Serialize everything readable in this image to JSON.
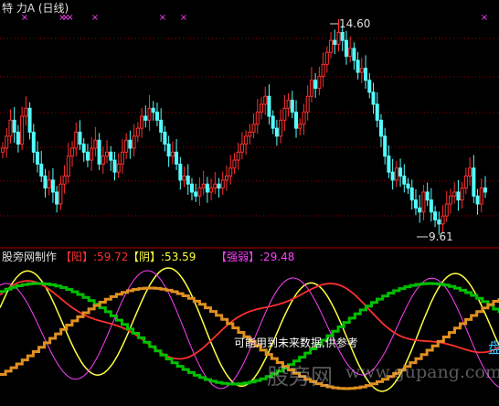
{
  "header": {
    "title": "特 力A (日线)"
  },
  "price_panel": {
    "high_label": "14.60",
    "low_label": "9.61"
  },
  "indicator_panel": {
    "label_prefix": "股旁网制作",
    "yang": {
      "name": "【阳】",
      "value": ":59.72",
      "color": "#ff3030"
    },
    "yin": {
      "name": "【阴】",
      "value": ":53.59",
      "color": "#ffff40"
    },
    "qiangruo": {
      "name": "【强弱】",
      "value": ":29.48",
      "color": "#ff40ff"
    },
    "note": "可能用到未来数据,供参考",
    "side_glyph": "盘"
  },
  "watermark": {
    "cn": "股旁网",
    "url": "www.gupang.com"
  },
  "colors": {
    "up": "#ff3030",
    "down": "#54ffff",
    "grid": "#a00000",
    "signal": "#ff40ff",
    "green_step": "#00c000",
    "orange_step": "#e09020"
  },
  "chart_data": [
    {
      "type": "candlestick",
      "title": "特 力A (日线)",
      "annotations": [
        {
          "text": "14.60",
          "kind": "high"
        },
        {
          "text": "9.61",
          "kind": "low"
        }
      ],
      "close": [
        11.6,
        11.9,
        12.3,
        12.0,
        11.7,
        12.4,
        12.6,
        12.0,
        11.5,
        11.2,
        10.9,
        10.6,
        10.8,
        10.5,
        10.2,
        10.7,
        10.9,
        11.4,
        11.6,
        12.0,
        11.7,
        11.5,
        11.3,
        11.6,
        11.8,
        11.2,
        11.4,
        11.5,
        11.3,
        11.0,
        11.2,
        11.5,
        11.8,
        11.6,
        11.9,
        12.1,
        12.4,
        12.3,
        12.6,
        12.5,
        12.3,
        12.0,
        11.7,
        11.4,
        11.5,
        11.2,
        10.8,
        10.9,
        10.7,
        10.5,
        10.4,
        10.6,
        10.7,
        10.5,
        10.6,
        10.7,
        10.6,
        10.8,
        10.9,
        11.1,
        11.3,
        11.5,
        11.7,
        11.9,
        12.0,
        12.2,
        12.5,
        12.7,
        12.9,
        12.4,
        12.1,
        11.9,
        12.3,
        12.6,
        12.8,
        12.5,
        12.1,
        12.2,
        12.5,
        12.9,
        13.3,
        13.1,
        13.4,
        13.7,
        14.0,
        14.3,
        14.2,
        14.5,
        14.3,
        13.9,
        14.1,
        13.8,
        13.5,
        13.6,
        13.3,
        13.0,
        12.7,
        12.3,
        11.9,
        11.4,
        11.0,
        10.8,
        11.1,
        10.9,
        10.7,
        10.6,
        10.3,
        10.1,
        10.0,
        10.5,
        10.3,
        10.0,
        9.8,
        9.7,
        9.9,
        10.2,
        10.4,
        10.5,
        10.3,
        10.6,
        10.9,
        11.1,
        10.4,
        10.2,
        10.6,
        10.5
      ]
    },
    {
      "type": "line",
      "series": [
        {
          "name": "【阳】",
          "color": "#ff3030",
          "last": 59.72
        },
        {
          "name": "【阴】",
          "color": "#ffff40",
          "last": 53.59
        },
        {
          "name": "【强弱】",
          "color": "#ff40ff",
          "last": 29.48
        }
      ]
    }
  ]
}
